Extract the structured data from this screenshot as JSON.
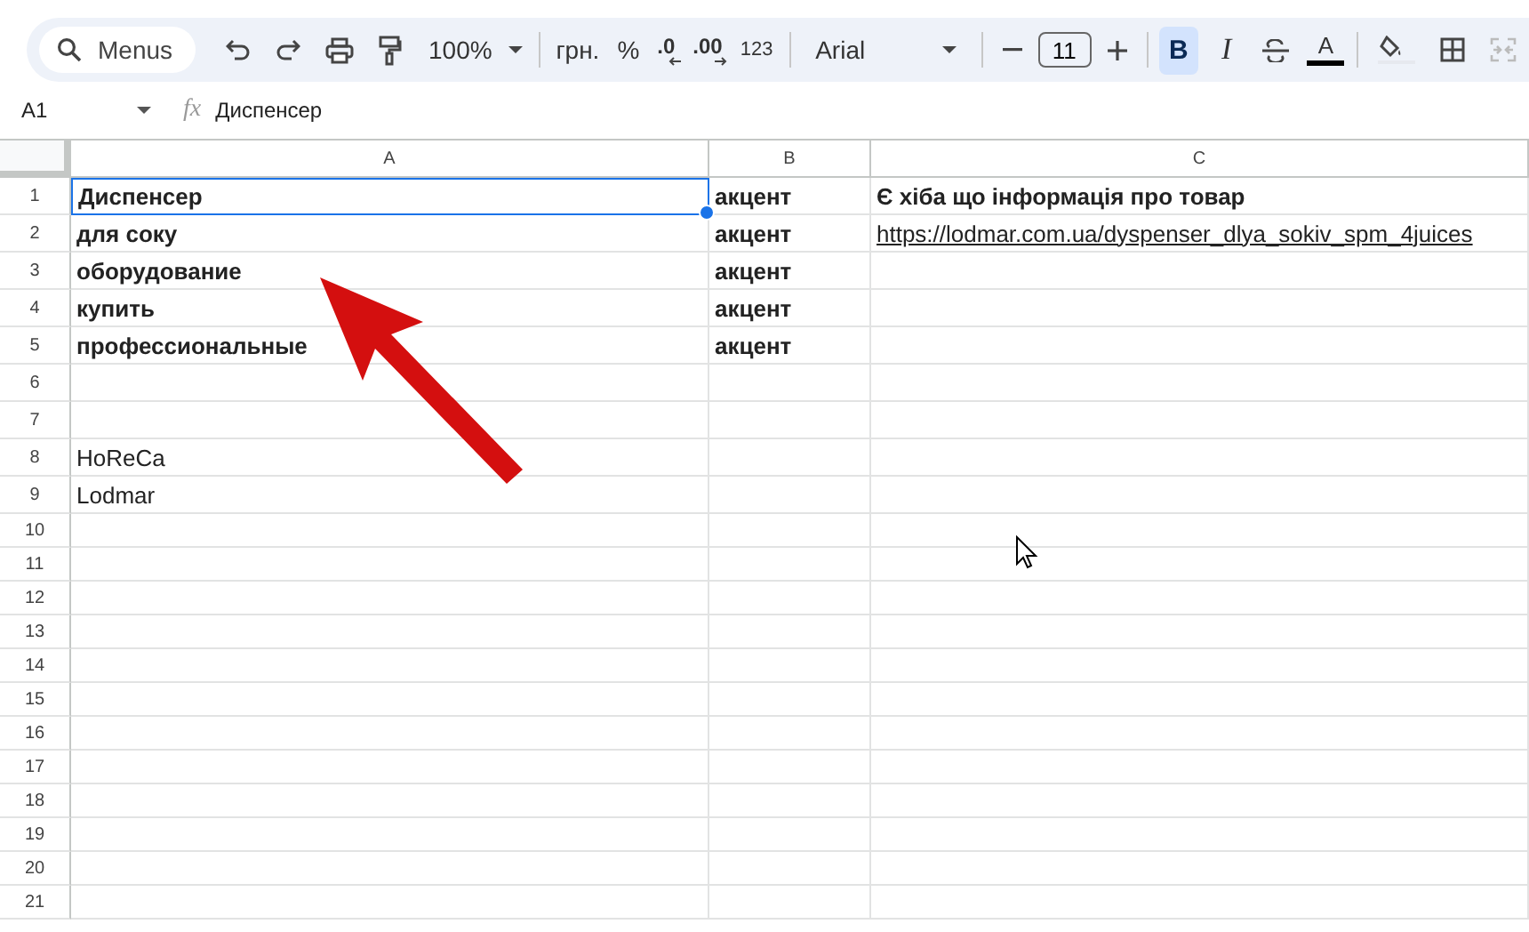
{
  "toolbar": {
    "search": {
      "placeholder": "Menus"
    },
    "zoom": "100%",
    "currency": "грн.",
    "percent": "%",
    "decrease_decimals": ".0",
    "increase_decimals": ".00",
    "number_format": "123",
    "font": "Arial",
    "font_size": "11",
    "bold": {
      "label": "B",
      "selected": true
    },
    "italic": {
      "label": "I",
      "selected": false
    },
    "text_color": {
      "label": "A",
      "color": "#000000"
    }
  },
  "formula_bar": {
    "cell_ref": "A1",
    "function_label": "fx",
    "value": "Диспенсер"
  },
  "columns": [
    "A",
    "B",
    "C"
  ],
  "rows": [
    {
      "number": "1",
      "cells": [
        {
          "text": "Диспенсер",
          "bold": true,
          "kind": "text",
          "selected": true
        },
        {
          "text": "акцент",
          "bold": true,
          "kind": "text",
          "selected": false
        },
        {
          "text": "Є хіба що інформація про товар",
          "bold": true,
          "kind": "text",
          "selected": false
        }
      ]
    },
    {
      "number": "2",
      "cells": [
        {
          "text": "для соку",
          "bold": true,
          "kind": "text",
          "selected": false
        },
        {
          "text": "акцент",
          "bold": true,
          "kind": "text",
          "selected": false
        },
        {
          "text": "https://lodmar.com.ua/dyspenser_dlya_sokiv_spm_4juices",
          "bold": false,
          "kind": "link",
          "selected": false
        }
      ]
    },
    {
      "number": "3",
      "cells": [
        {
          "text": "оборудование",
          "bold": true,
          "kind": "text",
          "selected": false
        },
        {
          "text": "акцент",
          "bold": true,
          "kind": "text",
          "selected": false
        },
        null
      ]
    },
    {
      "number": "4",
      "cells": [
        {
          "text": "купить",
          "bold": true,
          "kind": "text",
          "selected": false
        },
        {
          "text": "акцент",
          "bold": true,
          "kind": "text",
          "selected": false
        },
        null
      ]
    },
    {
      "number": "5",
      "cells": [
        {
          "text": "профессиональные",
          "bold": true,
          "kind": "text",
          "selected": false
        },
        {
          "text": "акцент",
          "bold": true,
          "kind": "text",
          "selected": false
        },
        null
      ]
    },
    {
      "number": "6",
      "cells": [
        null,
        null,
        null
      ]
    },
    {
      "number": "7",
      "cells": [
        null,
        null,
        null
      ]
    },
    {
      "number": "8",
      "cells": [
        {
          "text": "HoReCa",
          "bold": false,
          "kind": "text",
          "selected": false
        },
        null,
        null
      ]
    },
    {
      "number": "9",
      "cells": [
        {
          "text": "Lodmar",
          "bold": false,
          "kind": "text",
          "selected": false
        },
        null,
        null
      ]
    },
    {
      "number": "10",
      "cells": [
        null,
        null,
        null
      ]
    },
    {
      "number": "11",
      "cells": [
        null,
        null,
        null
      ]
    },
    {
      "number": "12",
      "cells": [
        null,
        null,
        null
      ]
    },
    {
      "number": "13",
      "cells": [
        null,
        null,
        null
      ]
    },
    {
      "number": "14",
      "cells": [
        null,
        null,
        null
      ]
    },
    {
      "number": "15",
      "cells": [
        null,
        null,
        null
      ]
    },
    {
      "number": "16",
      "cells": [
        null,
        null,
        null
      ]
    },
    {
      "number": "17",
      "cells": [
        null,
        null,
        null
      ]
    },
    {
      "number": "18",
      "cells": [
        null,
        null,
        null
      ]
    },
    {
      "number": "19",
      "cells": [
        null,
        null,
        null
      ]
    },
    {
      "number": "20",
      "cells": [
        null,
        null,
        null
      ]
    },
    {
      "number": "21",
      "cells": [
        null,
        null,
        null
      ]
    }
  ]
}
